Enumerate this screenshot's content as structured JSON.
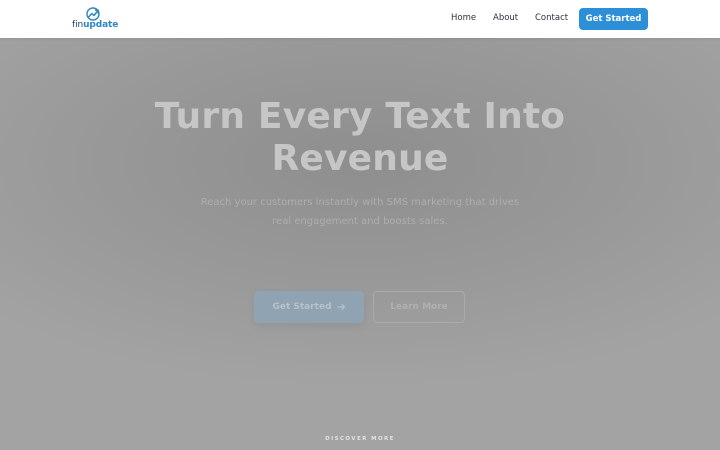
{
  "brand": {
    "name_plain": "fin",
    "name_bold": "update",
    "accent_color": "#2d8fd8"
  },
  "nav": {
    "items": [
      {
        "label": "Home"
      },
      {
        "label": "About"
      },
      {
        "label": "Contact"
      }
    ],
    "cta_label": "Get Started"
  },
  "hero": {
    "title_line1": "Turn Every Text Into",
    "title_line2": "Revenue",
    "subtitle_line1": "Reach your customers instantly with SMS marketing that drives",
    "subtitle_line2": "real engagement and boosts sales.",
    "primary_button": {
      "label": "Get Started",
      "icon": "arrow-right-icon"
    },
    "secondary_button": {
      "label": "Learn More"
    }
  },
  "discover": {
    "label": "DISCOVER MORE",
    "icon": "arrow-down-circle-icon"
  }
}
